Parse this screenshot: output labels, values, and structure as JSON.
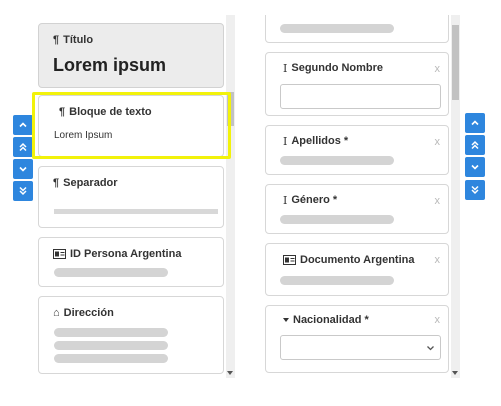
{
  "left_nav": {
    "buttons": [
      {
        "name": "move-up-button",
        "icon": "chevron-up-icon"
      },
      {
        "name": "move-top-button",
        "icon": "double-chevron-up-icon"
      },
      {
        "name": "move-down-button",
        "icon": "chevron-down-icon"
      },
      {
        "name": "move-bottom-button",
        "icon": "double-chevron-down-icon"
      }
    ]
  },
  "palette": {
    "titulo": {
      "label": "Título",
      "icon_glyph": "¶",
      "sample": "Lorem ipsum"
    },
    "bloque": {
      "label": "Bloque de texto",
      "icon_glyph": "¶",
      "sample": "Lorem Ipsum"
    },
    "separador": {
      "label": "Separador",
      "icon_glyph": "¶"
    },
    "id_persona": {
      "label": "ID Persona Argentina"
    },
    "direccion": {
      "label": "Dirección",
      "icon_glyph": "⌂"
    }
  },
  "form": {
    "segundo_nombre": {
      "label": "Segundo Nombre",
      "icon_glyph": "I",
      "close": "x"
    },
    "apellidos": {
      "label": "Apellidos *",
      "icon_glyph": "I",
      "close": "x"
    },
    "genero": {
      "label": "Género *",
      "icon_glyph": "I",
      "close": "x"
    },
    "documento": {
      "label": "Documento Argentina",
      "close": "x"
    },
    "nacionalidad": {
      "label": "Nacionalidad *",
      "close": "x"
    }
  },
  "colors": {
    "accent": "#2e86de",
    "highlight": "#f2f20a",
    "placeholder_bar": "#d4d4d4"
  }
}
